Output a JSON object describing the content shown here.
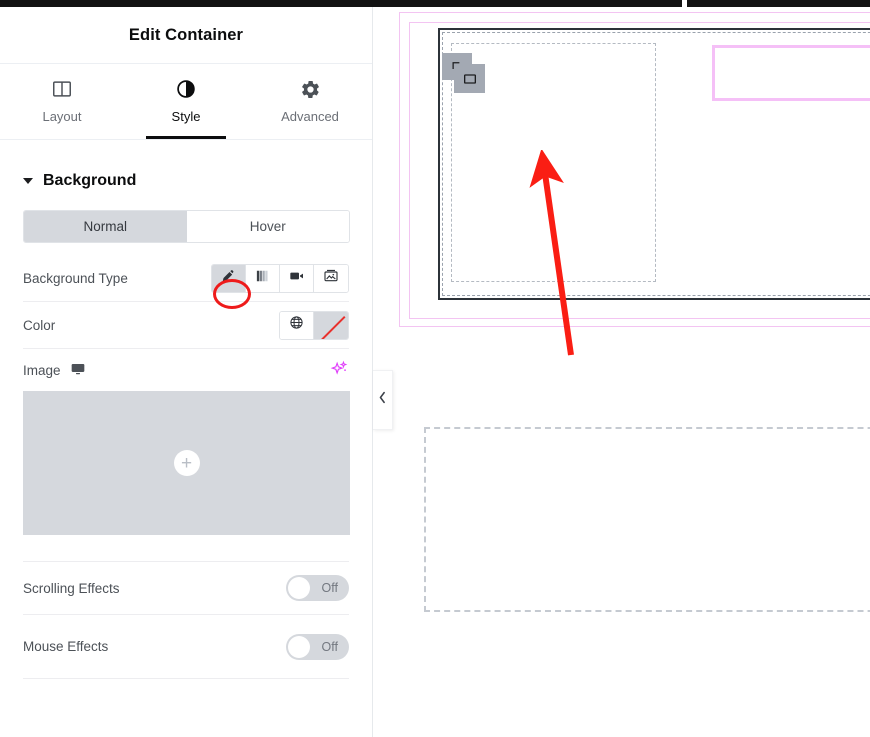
{
  "panel": {
    "title": "Edit Container",
    "tabs": [
      {
        "label": "Layout",
        "icon": "columns-icon",
        "active": false
      },
      {
        "label": "Style",
        "icon": "contrast-icon",
        "active": true
      },
      {
        "label": "Advanced",
        "icon": "gear-icon",
        "active": false
      }
    ],
    "section": {
      "title": "Background",
      "expanded": true,
      "state_tabs": {
        "normal": "Normal",
        "hover": "Hover",
        "selected": "Normal"
      },
      "background_type": {
        "label": "Background Type",
        "options": [
          {
            "name": "classic",
            "icon": "brush-icon",
            "selected": true
          },
          {
            "name": "gradient",
            "icon": "gradient-icon",
            "selected": false
          },
          {
            "name": "video",
            "icon": "video-icon",
            "selected": false
          },
          {
            "name": "slideshow",
            "icon": "slideshow-icon",
            "selected": false
          }
        ]
      },
      "color": {
        "label": "Color",
        "globe_icon": "globe-icon",
        "swatch_icon": "no-color-swatch",
        "value": ""
      },
      "image": {
        "label": "Image",
        "device_icon": "desktop-icon",
        "ai_icon": "ai-sparkle-icon",
        "add_icon": "plus-icon",
        "value": ""
      },
      "scrolling_effects": {
        "label": "Scrolling Effects",
        "state": "Off"
      },
      "mouse_effects": {
        "label": "Mouse Effects",
        "state": "Off"
      }
    }
  },
  "canvas": {
    "collapse_icon": "chevron-left-icon",
    "handles": [
      {
        "icon": "container-handle-icon"
      },
      {
        "icon": "rectangle-handle-icon"
      }
    ],
    "elements": {
      "section_outline": "section-outline",
      "selected_container": "selected-container",
      "child_container": "child-container",
      "widget_box": "widget-outline-box",
      "right_container": "right-container",
      "empty_container": "empty-dashed-container"
    }
  },
  "annotations": {
    "ellipse": {
      "target": "background-type-classic-option",
      "color": "#ee1b1b"
    },
    "arrow": {
      "target": "selected-container",
      "color": "#fa1e14"
    }
  },
  "colors": {
    "accent_dark": "#0c0d0e",
    "text_muted": "#6b6f76",
    "control_bg": "#d5d8dd",
    "outline_pink": "#f3c4f2",
    "container_border": "#2c3239",
    "annotation_red": "#ee1b1b",
    "ai_magenta": "#e040fb"
  }
}
